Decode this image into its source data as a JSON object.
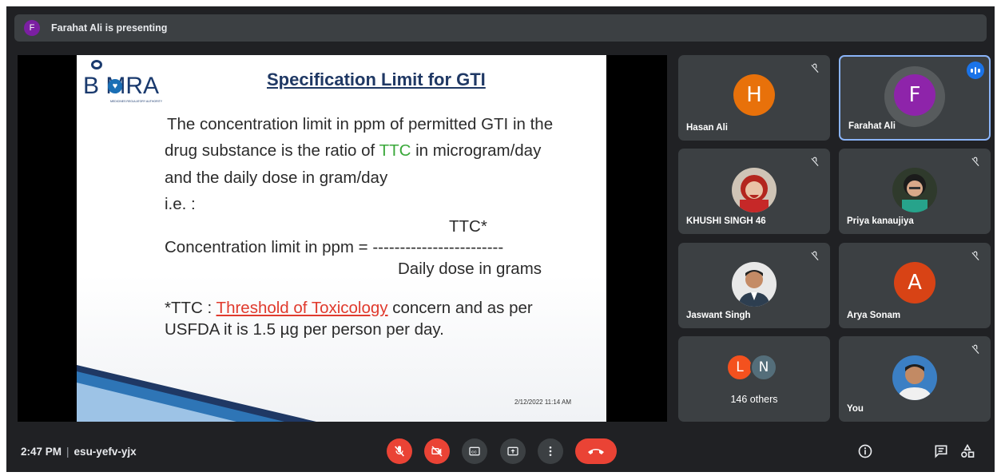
{
  "presenting_bar": {
    "avatar_letter": "F",
    "text": "Farahat Ali is presenting"
  },
  "slide": {
    "logo_text": "B MRA",
    "logo_sub": "MEDICINES REGULATORY AUTHORITY",
    "title": "Specification Limit for GTI",
    "line1": "The concentration limit in ppm of permitted GTI in the",
    "line2_pre": "drug substance is the ratio of ",
    "line2_green": "TTC",
    "line2_post": " in microgram/day",
    "line3": "and the daily dose in gram/day",
    "line4": "i.e. :",
    "numerator": "TTC*",
    "formula_label": "Concentration limit in ppm = ",
    "dashes": "------------------------",
    "denominator": "Daily dose in grams",
    "note_pre": "*TTC : ",
    "note_red": "Threshold of Toxicology",
    "note_post": " concern and as per",
    "note_line2": "USFDA it is 1.5 µg per person per day.",
    "datetime": "2/12/2022 11:14 AM"
  },
  "participants": [
    {
      "name": "Hasan Ali",
      "avatar": "H",
      "color": "#e8710a"
    },
    {
      "name": "Farahat Ali",
      "avatar": "F",
      "color": "#8e24aa"
    },
    {
      "name": "KHUSHI SINGH 46"
    },
    {
      "name": "Priya kanaujiya"
    },
    {
      "name": "Jaswant Singh"
    },
    {
      "name": "Arya Sonam",
      "avatar": "A",
      "color": "#d84315"
    },
    {
      "name": "You"
    }
  ],
  "others": {
    "avatar1": "L",
    "avatar1_color": "#f4511e",
    "avatar2": "N",
    "avatar2_color": "#546e7a",
    "label": "146  others"
  },
  "bottom_bar": {
    "time": "2:47 PM",
    "meeting_code": "esu-yefv-yjx"
  },
  "icons": [
    "mic-off-icon",
    "camera-off-icon",
    "captions-icon",
    "present-icon",
    "more-icon",
    "end-call-icon",
    "info-icon",
    "chat-icon",
    "activities-icon"
  ]
}
